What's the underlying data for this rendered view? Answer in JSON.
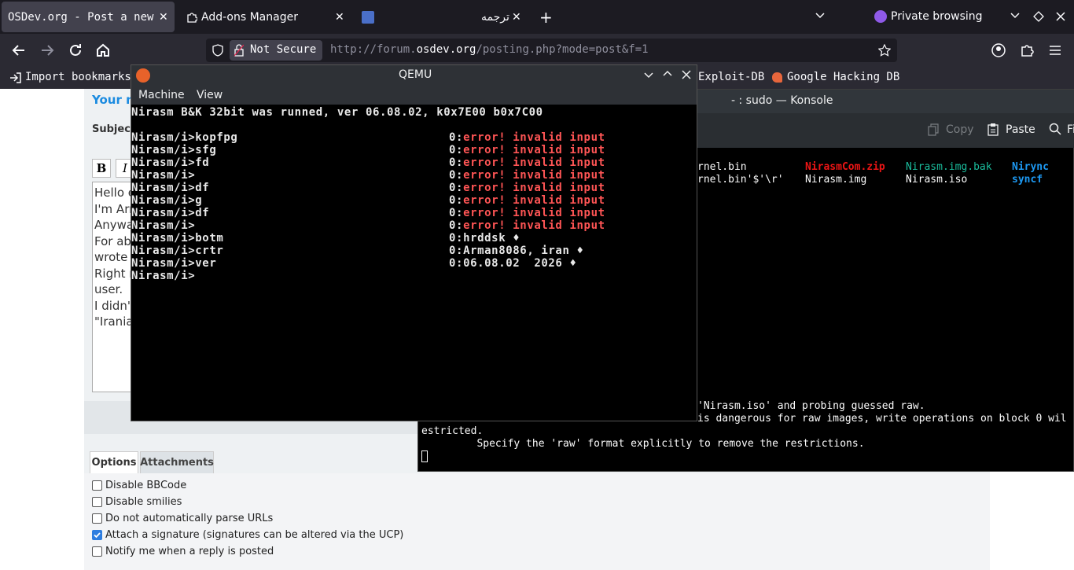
{
  "tabs": [
    {
      "label": "OSDev.org - Post a new",
      "close": "✕"
    },
    {
      "label": "Add-ons Manager",
      "close": "✕"
    },
    {
      "label": "ترجمه",
      "close": "✕"
    }
  ],
  "tabbar": {
    "new_tab": "+",
    "list": "⌄",
    "private": "Private browsing"
  },
  "urlbar": {
    "security": "Not Secure",
    "url_prefix": "http://forum.",
    "url_domain": "osdev.org",
    "url_path": "/posting.php?mode=post&f=1"
  },
  "bookmarks": {
    "import": "Import bookmarks...",
    "exploit_db": "Exploit-DB",
    "ghdb": "Google Hacking DB"
  },
  "forum": {
    "heading": "Your m",
    "subject_label": "Subject:",
    "bold": "B",
    "italic": "I",
    "body_lines": [
      "Hello e",
      "I'm Arr",
      "Anywa",
      "For ab",
      "wrote",
      "Right r",
      "user.",
      "I didn't",
      "\"Irania"
    ],
    "tab_options": "Options",
    "tab_attachments": "Attachments",
    "options": [
      {
        "label": "Disable BBCode",
        "checked": false
      },
      {
        "label": "Disable smilies",
        "checked": false
      },
      {
        "label": "Do not automatically parse URLs",
        "checked": false
      },
      {
        "label": "Attach a signature (signatures can be altered via the UCP)",
        "checked": true
      },
      {
        "label": "Notify me when a reply is posted",
        "checked": false
      }
    ]
  },
  "konsole": {
    "title": "- : sudo — Konsole",
    "copy": "Copy",
    "paste": "Paste",
    "find": "Fi",
    "files": {
      "col1a": "rnel.bin",
      "col1b": "rnel.bin'$'\\r'",
      "col2a": "NirasmCom.zip",
      "col2b": "Nirasm.img",
      "col3a": "Nirasm.img.bak",
      "col3b": "Nirasm.iso",
      "col4a": "Nirync",
      "col4b": "syncf"
    },
    "out1": "'Nirasm.iso' and probing guessed raw.",
    "out2": "is dangerous for raw images, write operations on block 0 wil",
    "out3": "estricted.",
    "out4": "         Specify the 'raw' format explicitly to remove the restrictions."
  },
  "qemu": {
    "title": "QEMU",
    "menu_machine": "Machine",
    "menu_view": "View",
    "banner": "Nirasm B&K 32bit was runned, ver 06.08.02, k0x7E00 b0x7C00",
    "lines": [
      {
        "cmd": "Nirasm/i>kopfpg",
        "prefix": "0:",
        "msg": "error! invalid input",
        "error": true
      },
      {
        "cmd": "Nirasm/i>sfg",
        "prefix": "0:",
        "msg": "error! invalid input",
        "error": true
      },
      {
        "cmd": "Nirasm/i>fd",
        "prefix": "0:",
        "msg": "error! invalid input",
        "error": true
      },
      {
        "cmd": "Nirasm/i>",
        "prefix": "0:",
        "msg": "error! invalid input",
        "error": true
      },
      {
        "cmd": "Nirasm/i>df",
        "prefix": "0:",
        "msg": "error! invalid input",
        "error": true
      },
      {
        "cmd": "Nirasm/i>g",
        "prefix": "0:",
        "msg": "error! invalid input",
        "error": true
      },
      {
        "cmd": "Nirasm/i>df",
        "prefix": "0:",
        "msg": "error! invalid input",
        "error": true
      },
      {
        "cmd": "Nirasm/i>",
        "prefix": "0:",
        "msg": "error! invalid input",
        "error": true
      },
      {
        "cmd": "Nirasm/i>botm",
        "prefix": "0:",
        "msg": "hrddsk ♦",
        "error": false
      },
      {
        "cmd": "Nirasm/i>crtr",
        "prefix": "0:",
        "msg": "Arman8086, iran ♦",
        "error": false
      },
      {
        "cmd": "Nirasm/i>ver",
        "prefix": "0:",
        "msg": "06.08.02  2026 ♦",
        "error": false
      }
    ],
    "prompt": "Nirasm/i>"
  }
}
